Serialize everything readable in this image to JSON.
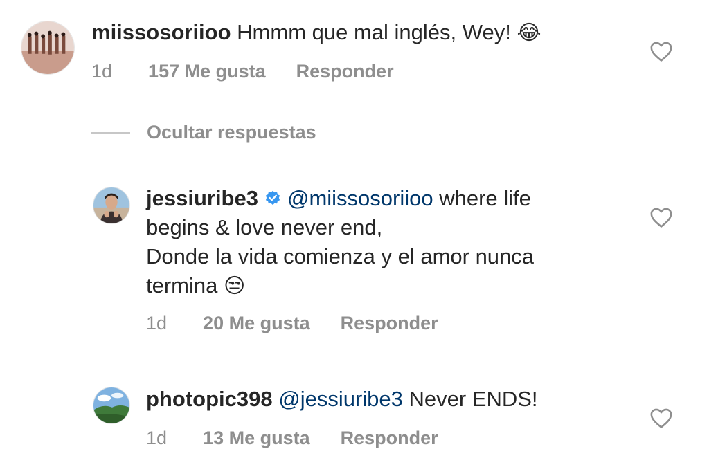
{
  "comments": [
    {
      "username": "miissosoriioo",
      "text": "Hmmm que mal inglés, Wey!",
      "emoji": "😂",
      "time": "1d",
      "likes": "157 Me gusta",
      "reply_label": "Responder"
    }
  ],
  "hide_replies_label": "Ocultar respuestas",
  "replies": [
    {
      "username": "jessiuribe3",
      "verified": true,
      "mention": "@miissosoriioo",
      "text_line1_after_mention": " where life",
      "text_line2": "begins & love never end,",
      "text_line3": "Donde la vida comienza y el amor nunca",
      "text_line4": "termina",
      "emoji": "😒",
      "time": "1d",
      "likes": "20 Me gusta",
      "reply_label": "Responder"
    },
    {
      "username": "photopic398",
      "mention": "@jessiuribe3",
      "text": " Never ENDS!",
      "time": "1d",
      "likes": "13 Me gusta",
      "reply_label": "Responder"
    }
  ],
  "icons": {
    "like": "heart-outline-icon",
    "verified": "verified-badge-icon"
  },
  "colors": {
    "text": "#262626",
    "secondary": "#8e8e8e",
    "mention": "#00376b",
    "verified": "#3897f0"
  }
}
